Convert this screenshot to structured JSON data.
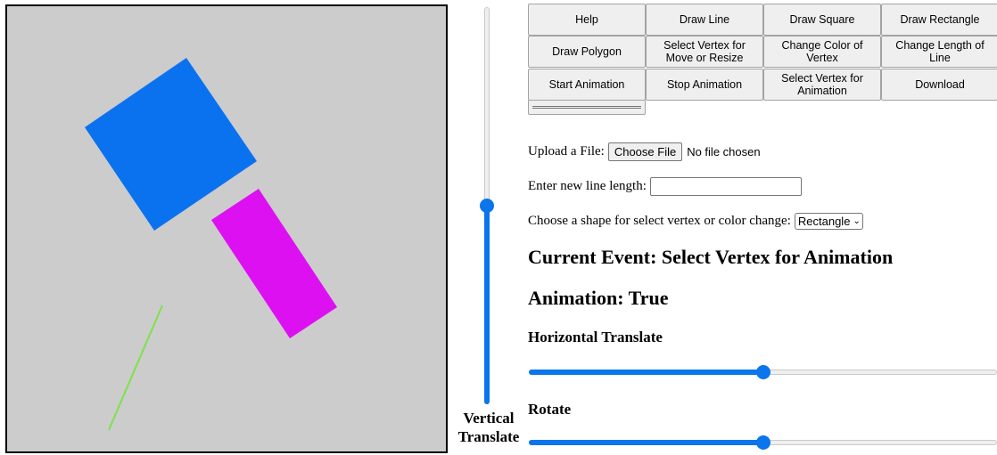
{
  "buttons": {
    "help": "Help",
    "draw_line": "Draw Line",
    "draw_square": "Draw Square",
    "draw_rectangle": "Draw Rectangle",
    "draw_polygon": "Draw Polygon",
    "select_vertex_move_resize": "Select Vertex for Move or Resize",
    "change_color_vertex": "Change Color of Vertex",
    "change_length_line": "Change Length of Line",
    "start_animation": "Start Animation",
    "stop_animation": "Stop Animation",
    "select_vertex_animation": "Select Vertex for Animation",
    "download": "Download"
  },
  "upload": {
    "label": "Upload a File:",
    "button": "Choose File",
    "status": "No file chosen"
  },
  "line_length": {
    "label": "Enter new line length:",
    "value": ""
  },
  "shape_select": {
    "label": "Choose a shape for select vertex or color change:",
    "selected": "Rectangle"
  },
  "current_event": "Current Event: Select Vertex for Animation",
  "animation_status": "Animation: True",
  "horizontal_translate": {
    "label": "Horizontal Translate",
    "value": 0.5
  },
  "rotate": {
    "label": "Rotate",
    "value": 0.5
  },
  "vertical_translate": {
    "label": "Vertical Translate",
    "value": 0.5
  },
  "canvas": {
    "background": "#cccccc",
    "shapes": [
      {
        "type": "square",
        "color": "#0b72ef"
      },
      {
        "type": "rectangle",
        "color": "#dd10f2"
      },
      {
        "type": "line",
        "color": "#7ee24a"
      }
    ]
  }
}
